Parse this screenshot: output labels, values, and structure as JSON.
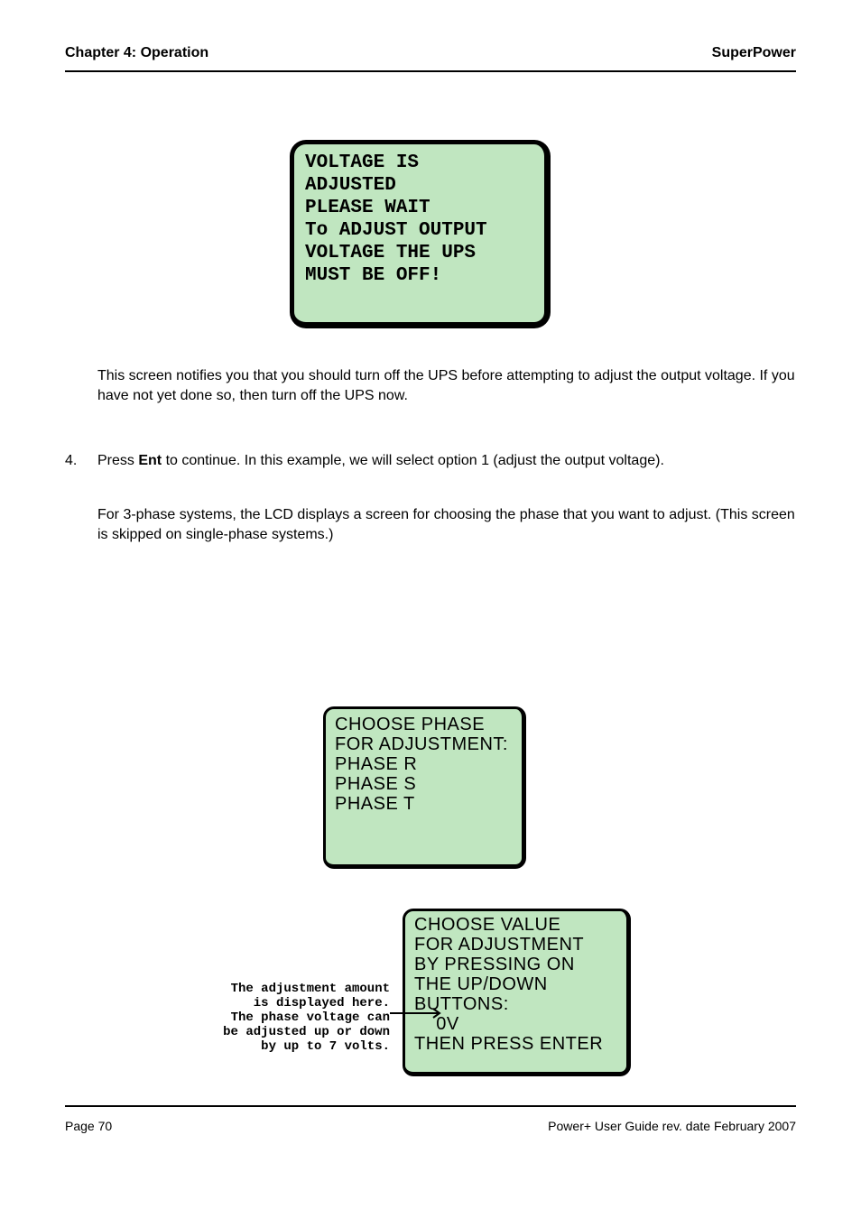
{
  "header": {
    "left": "Chapter 4: Operation",
    "right": "SuperPower"
  },
  "footer": {
    "left": "Page 70",
    "right": "Power+ User Guide rev. date February 2007"
  },
  "lcd1": {
    "l1": "VOLTAGE IS",
    "l2": "ADJUSTED",
    "l3": "PLEASE WAIT",
    "l4": "",
    "l5": "",
    "l6": "To ADJUST OUTPUT",
    "l7": "VOLTAGE THE UPS",
    "l8": "MUST BE OFF!"
  },
  "p1": "This screen notifies you that you should turn off the UPS before attempting to adjust the output voltage. If you have not yet done so, then turn off the UPS now.",
  "p2_a": "Press ",
  "p2_b": "Ent",
  "p2_c": " to continue. In this example, we will select option 1 (adjust the output voltage).",
  "p3": "For 3-phase systems, the LCD displays a screen for choosing the phase that you want to adjust. (This screen is skipped on single-phase systems.)",
  "lcd2": {
    "l1": "CHOOSE PHASE",
    "l2": "FOR ADJUSTMENT:",
    "l3": "",
    "l4": "",
    "l5": "PHASE R",
    "l6": "PHASE S",
    "l7": "PHASE T"
  },
  "lcd3": {
    "l1": "CHOOSE VALUE",
    "l2": "FOR ADJUSTMENT",
    "l3": "BY PRESSING ON",
    "l4": "THE UP/DOWN",
    "l5": "BUTTONS:",
    "l6": "    0V",
    "l7": "",
    "l8": "THEN PRESS ENTER"
  },
  "note3": "The adjustment amount\nis displayed here.\nThe phase voltage can\nbe adjusted up or down\nby up to 7 volts."
}
